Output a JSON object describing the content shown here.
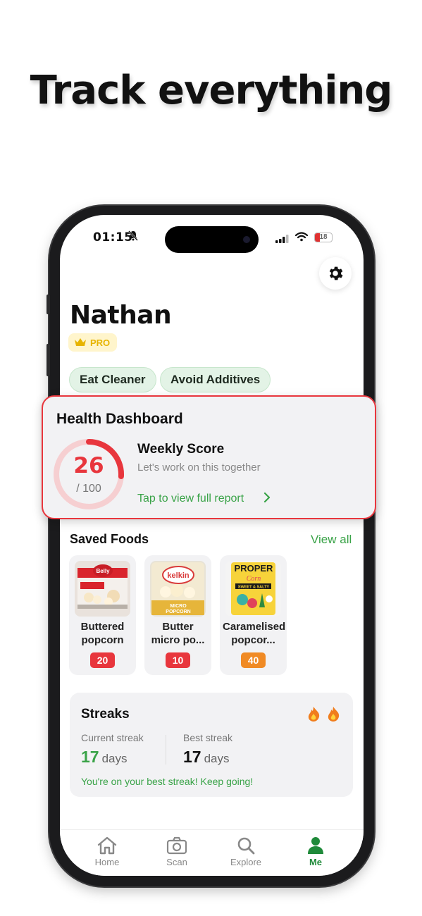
{
  "headline": "Track everything",
  "status_bar": {
    "time": "01:15",
    "battery": "18"
  },
  "profile": {
    "name": "Nathan",
    "badge": "PRO"
  },
  "goals": [
    "Eat Cleaner",
    "Avoid Additives"
  ],
  "dashboard": {
    "title": "Health Dashboard",
    "score": "26",
    "score_max": "/ 100",
    "score_value": 26,
    "weekly_title": "Weekly Score",
    "weekly_subtitle": "Let's work on this together",
    "link": "Tap to view full report"
  },
  "saved_foods": {
    "title": "Saved Foods",
    "view_all": "View all",
    "items": [
      {
        "name": "Buttered popcorn",
        "score": "20",
        "color": "#e8363d"
      },
      {
        "name": "Butter micro po...",
        "score": "10",
        "color": "#e8363d"
      },
      {
        "name": "Caramelised popcor...",
        "score": "40",
        "color": "#f08a24"
      }
    ]
  },
  "streaks": {
    "title": "Streaks",
    "current_label": "Current streak",
    "current_value": "17",
    "best_label": "Best streak",
    "best_value": "17",
    "unit": "days",
    "message": "You're on your best streak! Keep going!"
  },
  "tabs": [
    {
      "label": "Home",
      "icon": "home-icon"
    },
    {
      "label": "Scan",
      "icon": "camera-icon"
    },
    {
      "label": "Explore",
      "icon": "search-icon"
    },
    {
      "label": "Me",
      "icon": "person-icon",
      "active": true
    }
  ],
  "colors": {
    "accent_green": "#3aa348",
    "alert_red": "#e8363d",
    "warning_orange": "#f08a24",
    "pro_gold": "#e7b400"
  }
}
